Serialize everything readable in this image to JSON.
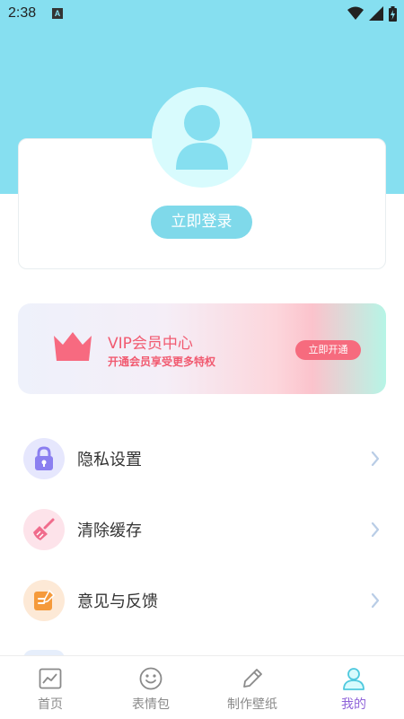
{
  "status_bar": {
    "time": "2:38",
    "notification_badge": "A"
  },
  "profile": {
    "login_label": "立即登录"
  },
  "vip": {
    "title": "VIP会员中心",
    "subtitle": "开通会员享受更多特权",
    "button_label": "立即开通"
  },
  "menu": {
    "items": [
      {
        "label": "隐私设置",
        "icon": "lock-icon",
        "color": "#8b7ff0"
      },
      {
        "label": "清除缓存",
        "icon": "broom-icon",
        "color": "#f06c8c"
      },
      {
        "label": "意见与反馈",
        "icon": "feedback-icon",
        "color": "#f59a3b"
      }
    ]
  },
  "tabs": [
    {
      "label": "首页",
      "icon": "home-chart-icon",
      "active": false
    },
    {
      "label": "表情包",
      "icon": "smiley-icon",
      "active": false
    },
    {
      "label": "制作壁纸",
      "icon": "pencil-icon",
      "active": false
    },
    {
      "label": "我的",
      "icon": "user-icon",
      "active": true
    }
  ],
  "colors": {
    "header": "#86dff0",
    "accent": "#8f63d9",
    "vip": "#f15a70"
  }
}
